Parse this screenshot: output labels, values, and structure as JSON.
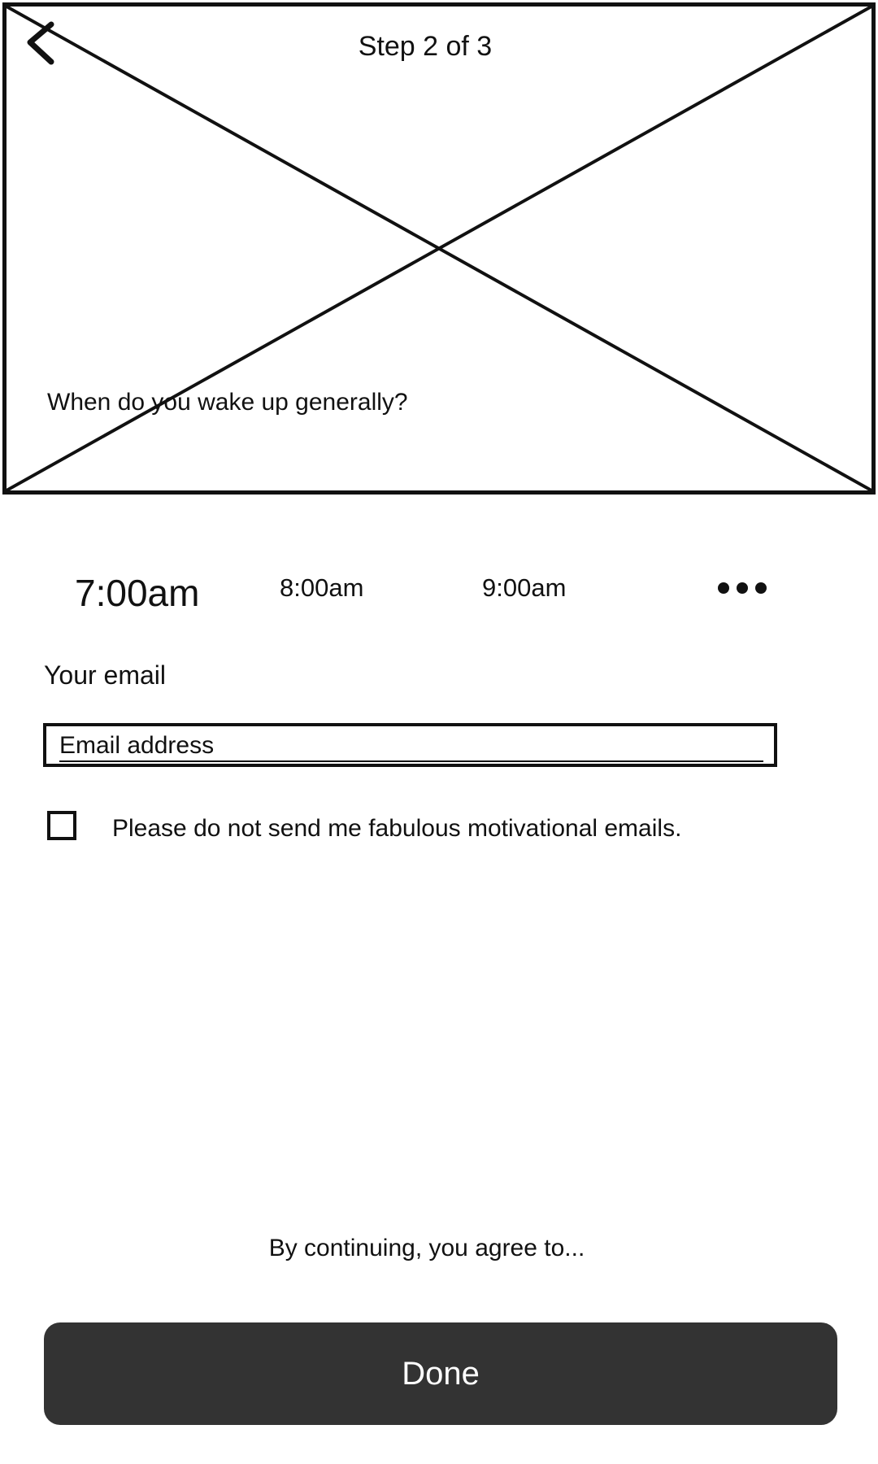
{
  "header": {
    "step_label": "Step 2 of 3",
    "back_icon": "chevron-left-icon"
  },
  "hero": {
    "image_placeholder": "image-placeholder",
    "question": "When do you wake up generally?"
  },
  "time_options": {
    "selected": "7:00am",
    "items": [
      "7:00am",
      "8:00am",
      "9:00am"
    ],
    "more_icon": "more-horizontal-icon"
  },
  "email": {
    "label": "Your email",
    "placeholder": "Email address",
    "value": ""
  },
  "opt_out": {
    "checked": false,
    "label": "Please do not send me fabulous motivational emails."
  },
  "footer": {
    "terms": "By continuing, you agree to...",
    "done_label": "Done"
  },
  "colors": {
    "stroke": "#111111",
    "button_bg": "#333333",
    "button_text": "#ffffff",
    "background": "#ffffff"
  }
}
